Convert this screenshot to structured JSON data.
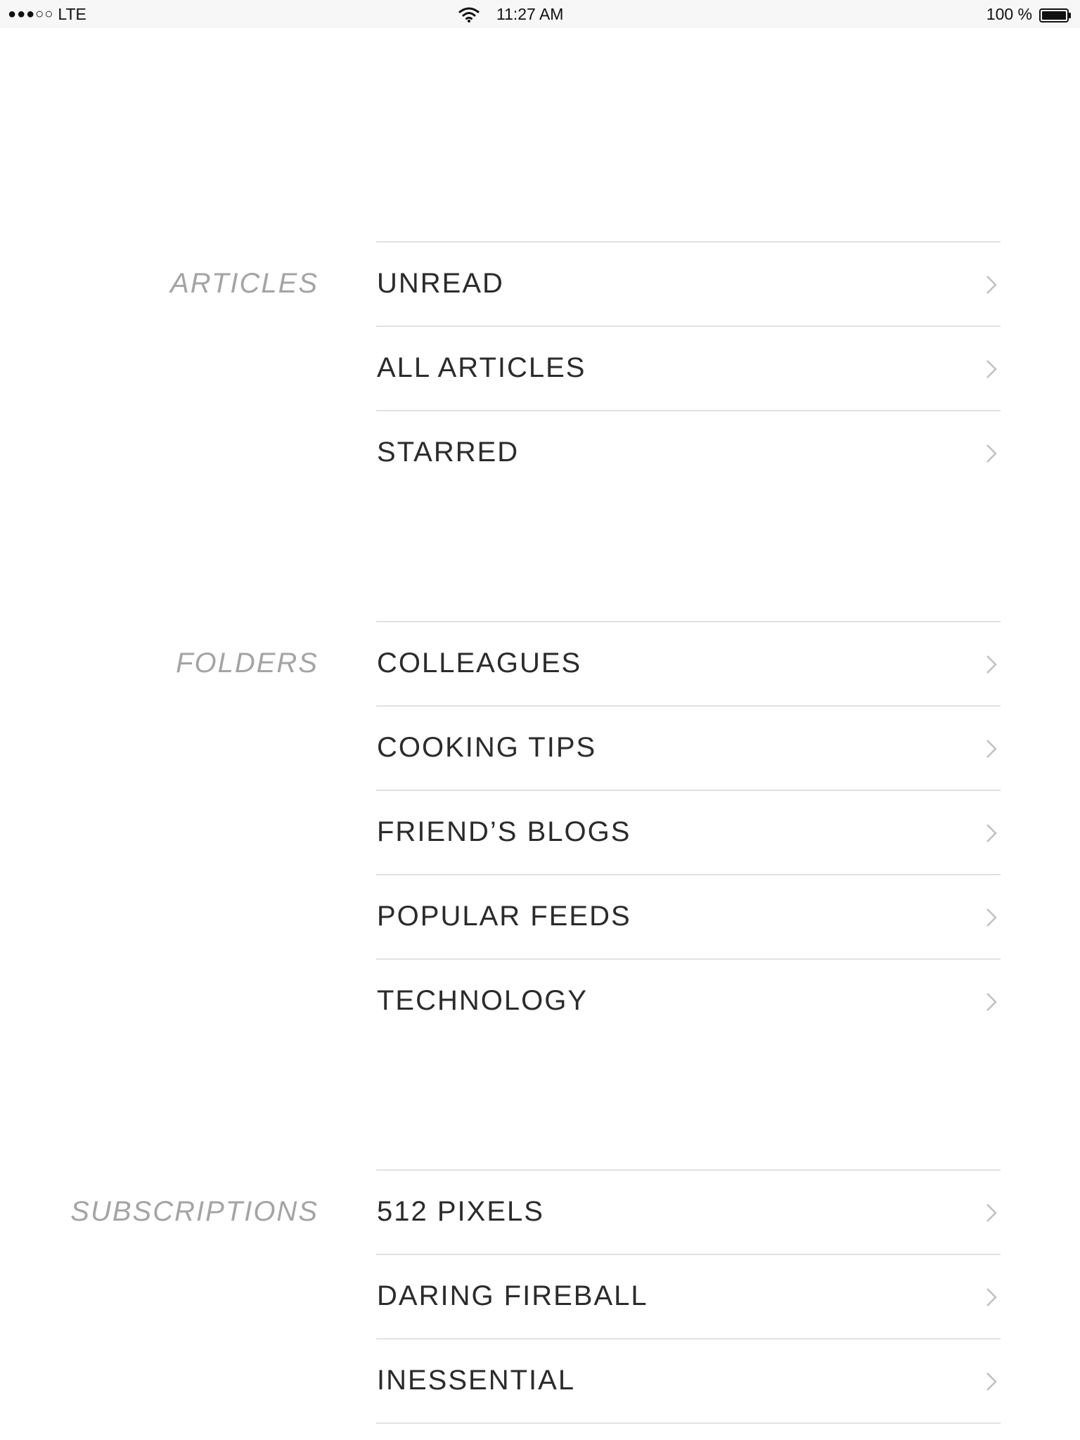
{
  "status_bar": {
    "signal": "●●●○○",
    "carrier": "LTE",
    "time": "11:27 AM",
    "battery": "100 %",
    "icons": [
      "wifi-icon",
      "battery-icon"
    ]
  },
  "sections": {
    "articles": {
      "label": "ARTICLES",
      "items": [
        "UNREAD",
        "ALL ARTICLES",
        "STARRED"
      ]
    },
    "folders": {
      "label": "FOLDERS",
      "items": [
        "COLLEAGUES",
        "COOKING TIPS",
        "FRIEND’S BLOGS",
        "POPULAR FEEDS",
        "TECHNOLOGY"
      ]
    },
    "subscriptions": {
      "label": "SUBSCRIPTIONS",
      "items": [
        "512 PIXELS",
        "DARING FIREBALL",
        "INESSENTIAL"
      ]
    }
  },
  "row_icon": "chevron-right-icon",
  "colors": {
    "section_label": "#a4a4a4",
    "item_text": "#2b2b2b",
    "divider": "#e1e1e1",
    "chevron": "#c0c0c0"
  }
}
